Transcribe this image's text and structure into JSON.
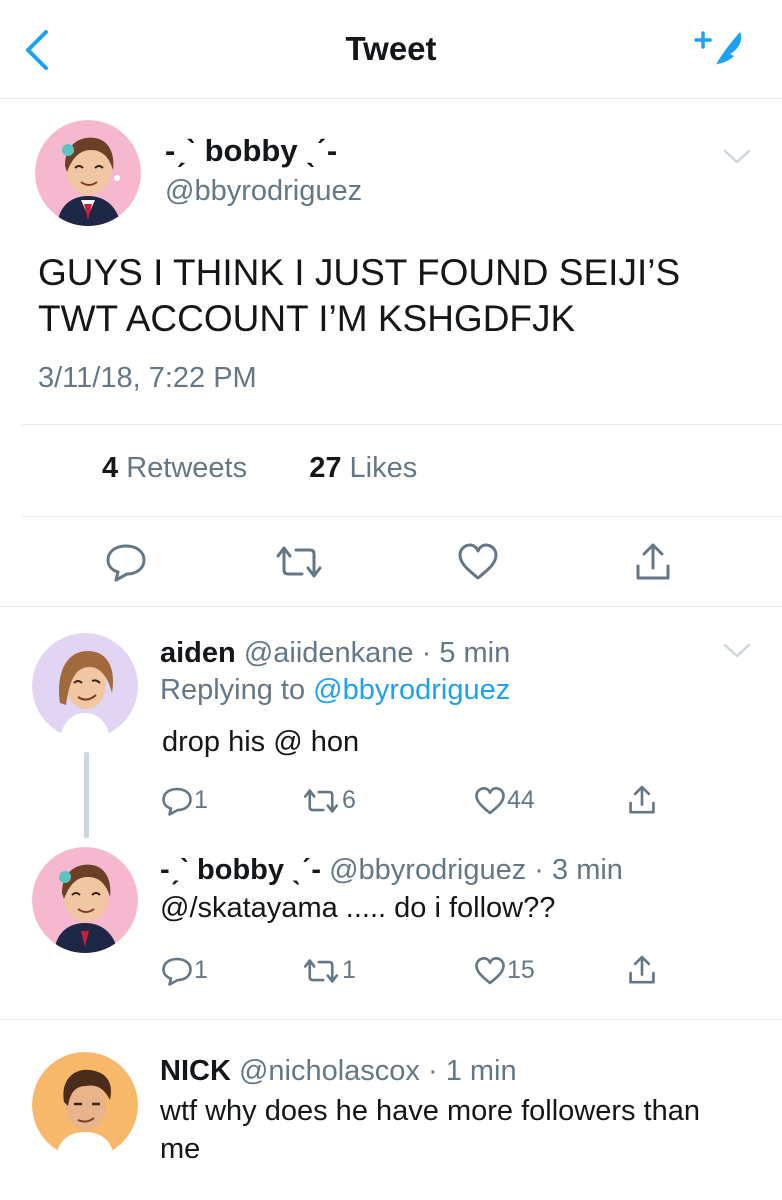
{
  "header": {
    "title": "Tweet"
  },
  "main_tweet": {
    "display_name": "-ˏˋ bobby ˎˊ-",
    "handle": "@bbyrodriguez",
    "text": "GUYS I THINK I JUST FOUND SEIJI’S TWT ACCOUNT I’M KSHGDFJK",
    "timestamp": "3/11/18, 7:22 PM",
    "retweets_count": "4",
    "retweets_label": "Retweets",
    "likes_count": "27",
    "likes_label": "Likes"
  },
  "replies": [
    {
      "display_name": "aiden",
      "handle": "@aiidenkane",
      "time": "5 min",
      "replying_prefix": "Replying to",
      "replying_handle": "@bbyrodriguez",
      "text": "drop his @ hon",
      "reply_count": "1",
      "retweet_count": "6",
      "like_count": "44"
    },
    {
      "display_name": "-ˏˋ bobby ˎˊ-",
      "handle": "@bbyrodriguez",
      "time": "3 min",
      "text": "@/skatayama ..... do i follow??",
      "reply_count": "1",
      "retweet_count": "1",
      "like_count": "15"
    },
    {
      "display_name": "NICK",
      "handle": "@nicholascox",
      "time": "1 min",
      "text": "wtf why does he have more followers than me"
    }
  ],
  "separator": "·",
  "colors": {
    "accent": "#1da1f2",
    "secondary_text": "#657786",
    "divider": "#e6ecf0"
  }
}
